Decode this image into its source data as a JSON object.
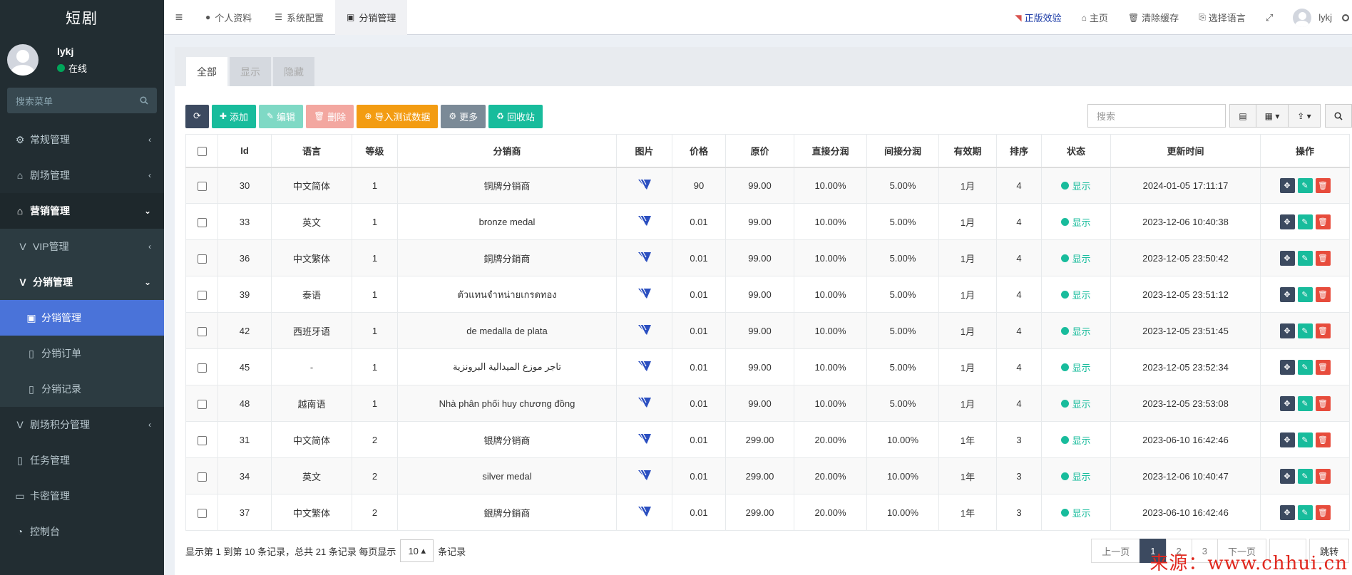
{
  "sidebar": {
    "brand": "短剧",
    "user": {
      "name": "lykj",
      "status": "在线"
    },
    "search_placeholder": "搜索菜单",
    "menu": [
      {
        "label": "常规管理",
        "icon": "gears-icon",
        "arrow": "‹",
        "level": 0
      },
      {
        "label": "剧场管理",
        "icon": "home-icon",
        "arrow": "‹",
        "level": 0
      },
      {
        "label": "营销管理",
        "icon": "home-icon",
        "arrow": "⌄",
        "level": 0,
        "open": true
      },
      {
        "label": "VIP管理",
        "icon": "v-icon",
        "arrow": "‹",
        "level": 1
      },
      {
        "label": "分销管理",
        "icon": "v-icon",
        "arrow": "⌄",
        "level": 1,
        "open": true
      },
      {
        "label": "分销管理",
        "icon": "v-square-icon",
        "level": 2,
        "active": true
      },
      {
        "label": "分销订单",
        "icon": "file-icon",
        "level": 2
      },
      {
        "label": "分销记录",
        "icon": "file-icon",
        "level": 2
      },
      {
        "label": "剧场积分管理",
        "icon": "v-icon",
        "arrow": "‹",
        "level": 0
      },
      {
        "label": "任务管理",
        "icon": "file-icon",
        "level": 0
      },
      {
        "label": "卡密管理",
        "icon": "card-icon",
        "level": 0
      },
      {
        "label": "控制台",
        "icon": "dashboard-icon",
        "level": 0
      }
    ]
  },
  "navbar": {
    "tabs": [
      {
        "label": "个人资料",
        "icon": "user-icon"
      },
      {
        "label": "系统配置",
        "icon": "sliders-icon"
      },
      {
        "label": "分销管理",
        "icon": "v-square-icon",
        "active": true
      }
    ],
    "links": [
      {
        "label": "正版效验",
        "icon": "rss-icon"
      },
      {
        "label": "主页",
        "icon": "home-icon"
      },
      {
        "label": "清除缓存",
        "icon": "trash-icon"
      },
      {
        "label": "选择语言",
        "icon": "language-icon"
      }
    ],
    "username": "lykj"
  },
  "panel": {
    "tabs": [
      "全部",
      "显示",
      "隐藏"
    ],
    "toolbar": {
      "add": "添加",
      "edit": "编辑",
      "delete": "删除",
      "import": "导入测试数据",
      "more": "更多",
      "recycle": "回收站",
      "search_placeholder": "搜索"
    }
  },
  "table": {
    "columns": [
      "Id",
      "语言",
      "等级",
      "分销商",
      "图片",
      "价格",
      "原价",
      "直接分润",
      "间接分润",
      "有效期",
      "排序",
      "状态",
      "更新时间",
      "操作"
    ],
    "rows": [
      {
        "id": "30",
        "lang": "中文简体",
        "level": "1",
        "name": "铜牌分销商",
        "price": "90",
        "orig": "99.00",
        "direct": "10.00%",
        "indirect": "5.00%",
        "period": "1月",
        "sort": "4",
        "status": "显示",
        "time": "2024-01-05 17:11:17"
      },
      {
        "id": "33",
        "lang": "英文",
        "level": "1",
        "name": "bronze medal",
        "price": "0.01",
        "orig": "99.00",
        "direct": "10.00%",
        "indirect": "5.00%",
        "period": "1月",
        "sort": "4",
        "status": "显示",
        "time": "2023-12-06 10:40:38"
      },
      {
        "id": "36",
        "lang": "中文繁体",
        "level": "1",
        "name": "銅牌分銷商",
        "price": "0.01",
        "orig": "99.00",
        "direct": "10.00%",
        "indirect": "5.00%",
        "period": "1月",
        "sort": "4",
        "status": "显示",
        "time": "2023-12-05 23:50:42"
      },
      {
        "id": "39",
        "lang": "泰语",
        "level": "1",
        "name": "ตัวแทนจำหน่ายเกรดทอง",
        "price": "0.01",
        "orig": "99.00",
        "direct": "10.00%",
        "indirect": "5.00%",
        "period": "1月",
        "sort": "4",
        "status": "显示",
        "time": "2023-12-05 23:51:12"
      },
      {
        "id": "42",
        "lang": "西班牙语",
        "level": "1",
        "name": "de medalla de plata",
        "price": "0.01",
        "orig": "99.00",
        "direct": "10.00%",
        "indirect": "5.00%",
        "period": "1月",
        "sort": "4",
        "status": "显示",
        "time": "2023-12-05 23:51:45"
      },
      {
        "id": "45",
        "lang": "-",
        "level": "1",
        "name": "تاجر موزع الميدالية البرونزية",
        "price": "0.01",
        "orig": "99.00",
        "direct": "10.00%",
        "indirect": "5.00%",
        "period": "1月",
        "sort": "4",
        "status": "显示",
        "time": "2023-12-05 23:52:34"
      },
      {
        "id": "48",
        "lang": "越南语",
        "level": "1",
        "name": "Nhà phân phối huy chương đồng",
        "price": "0.01",
        "orig": "99.00",
        "direct": "10.00%",
        "indirect": "5.00%",
        "period": "1月",
        "sort": "4",
        "status": "显示",
        "time": "2023-12-05 23:53:08"
      },
      {
        "id": "31",
        "lang": "中文简体",
        "level": "2",
        "name": "银牌分销商",
        "price": "0.01",
        "orig": "299.00",
        "direct": "20.00%",
        "indirect": "10.00%",
        "period": "1年",
        "sort": "3",
        "status": "显示",
        "time": "2023-06-10 16:42:46"
      },
      {
        "id": "34",
        "lang": "英文",
        "level": "2",
        "name": "silver medal",
        "price": "0.01",
        "orig": "299.00",
        "direct": "20.00%",
        "indirect": "10.00%",
        "period": "1年",
        "sort": "3",
        "status": "显示",
        "time": "2023-12-06 10:40:47"
      },
      {
        "id": "37",
        "lang": "中文繁体",
        "level": "2",
        "name": "銀牌分銷商",
        "price": "0.01",
        "orig": "299.00",
        "direct": "20.00%",
        "indirect": "10.00%",
        "period": "1年",
        "sort": "3",
        "status": "显示",
        "time": "2023-06-10 16:42:46"
      }
    ]
  },
  "footer": {
    "summary": "显示第 1 到第 10 条记录，总共 21 条记录 每页显示",
    "page_size": "10",
    "suffix": "条记录",
    "prev": "上一页",
    "pages": [
      "1",
      "2",
      "3"
    ],
    "current_page": "1",
    "next": "下一页",
    "jump": "跳转"
  },
  "watermark": "来源：www.chhui.cn",
  "colors": {
    "sidebar_bg": "#222d32",
    "active": "#4a73d9",
    "green": "#18bc9c",
    "dark": "#3c4a60"
  }
}
